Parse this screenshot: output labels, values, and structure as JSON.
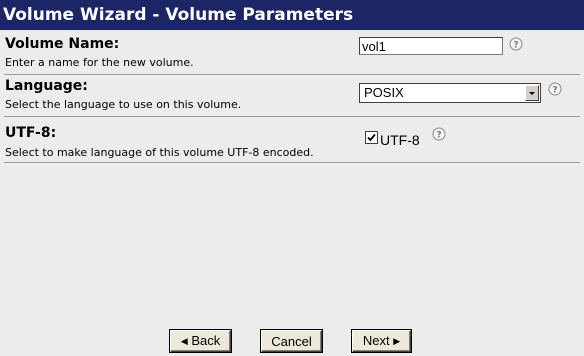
{
  "window": {
    "title": "Volume Wizard - Volume Parameters"
  },
  "fields": {
    "volume_name": {
      "label": "Volume Name:",
      "description": "Enter a name for the new volume.",
      "value": "vol1",
      "help_icon": "help-question-icon"
    },
    "language": {
      "label": "Language:",
      "description": "Select the language to use on this volume.",
      "selected": "POSIX",
      "help_icon": "help-question-icon"
    },
    "utf8": {
      "label": "UTF-8:",
      "description": "Select to make language of this volume UTF-8 encoded.",
      "checkbox_label": "UTF-8",
      "checked": true,
      "help_icon": "help-question-icon"
    }
  },
  "buttons": {
    "back_label": "Back",
    "cancel_label": "Cancel",
    "next_label": "Next"
  },
  "colors": {
    "title_bar": "#1c2566",
    "title_text": "#ffffff",
    "background": "#ececec"
  }
}
